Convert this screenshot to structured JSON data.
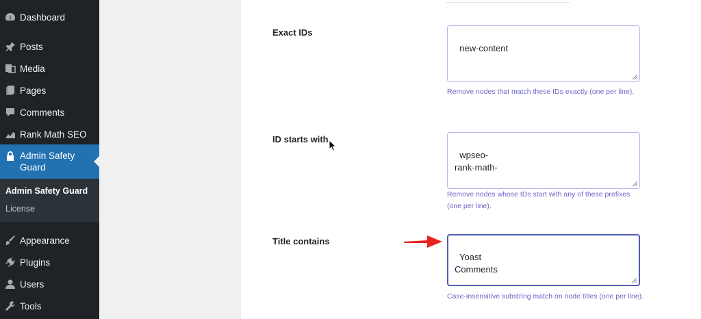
{
  "sidebar": {
    "items": [
      {
        "label": "Dashboard",
        "icon": "dashboard-icon"
      },
      {
        "label": "Posts",
        "icon": "pin-icon"
      },
      {
        "label": "Media",
        "icon": "media-icon"
      },
      {
        "label": "Pages",
        "icon": "pages-icon"
      },
      {
        "label": "Comments",
        "icon": "comments-icon"
      },
      {
        "label": "Rank Math SEO",
        "icon": "chart-icon"
      },
      {
        "label": "Admin Safety Guard",
        "icon": "lock-icon"
      },
      {
        "label": "Appearance",
        "icon": "brush-icon"
      },
      {
        "label": "Plugins",
        "icon": "plug-icon"
      },
      {
        "label": "Users",
        "icon": "user-icon"
      },
      {
        "label": "Tools",
        "icon": "wrench-icon"
      }
    ],
    "submenu": {
      "current": "Admin Safety Guard",
      "license": "License"
    }
  },
  "form": {
    "exact_ids": {
      "label": "Exact IDs",
      "value": "new-content",
      "description": "Remove nodes that match these IDs exactly (one per line)."
    },
    "id_starts_with": {
      "label": "ID starts with",
      "value": "wpseo-\nrank-math-",
      "description": "Remove nodes whose IDs start with any of these prefixes (one per line)."
    },
    "title_contains": {
      "label": "Title contains",
      "value": "Yoast\nComments",
      "description": "Case-insensitive substring match on node titles (one per line)."
    }
  },
  "colors": {
    "sidebar_bg": "#1d2327",
    "active_bg": "#2271b1",
    "description_text": "#6a65c8",
    "annotation_arrow": "#e8231c"
  }
}
